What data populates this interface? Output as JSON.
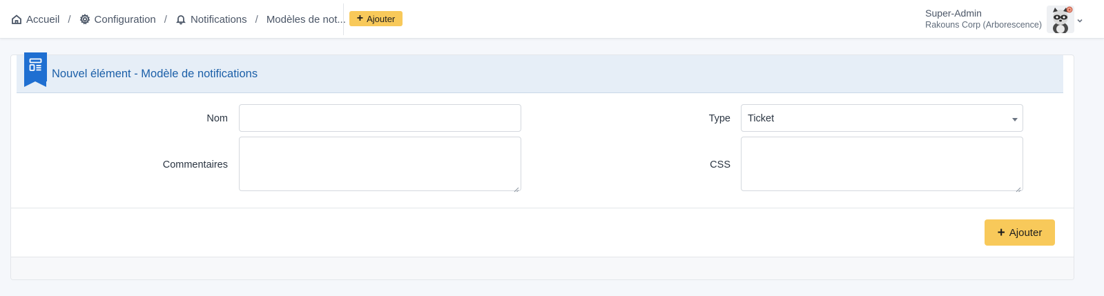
{
  "breadcrumb": {
    "home": "Accueil",
    "config": "Configuration",
    "notifications": "Notifications",
    "current": "Modèles de not..."
  },
  "topbar": {
    "add_label": "Ajouter",
    "user_name": "Super-Admin",
    "user_entity": "Rakouns Corp (Arborescence)"
  },
  "card": {
    "title": "Nouvel élément - Modèle de notifications"
  },
  "form": {
    "name_label": "Nom",
    "name_value": "",
    "comment_label": "Commentaires",
    "comment_value": "",
    "type_label": "Type",
    "type_value": "Ticket",
    "css_label": "CSS",
    "css_value": ""
  },
  "footer": {
    "submit_label": "Ajouter"
  },
  "colors": {
    "accent": "#f8c95a",
    "brand": "#1f6fd1",
    "title": "#1b5fa8",
    "header_bg": "#e6eef7"
  },
  "icons": [
    "home-icon",
    "gear-icon",
    "bell-icon",
    "plus-icon",
    "form-icon",
    "chevron-down-icon"
  ]
}
